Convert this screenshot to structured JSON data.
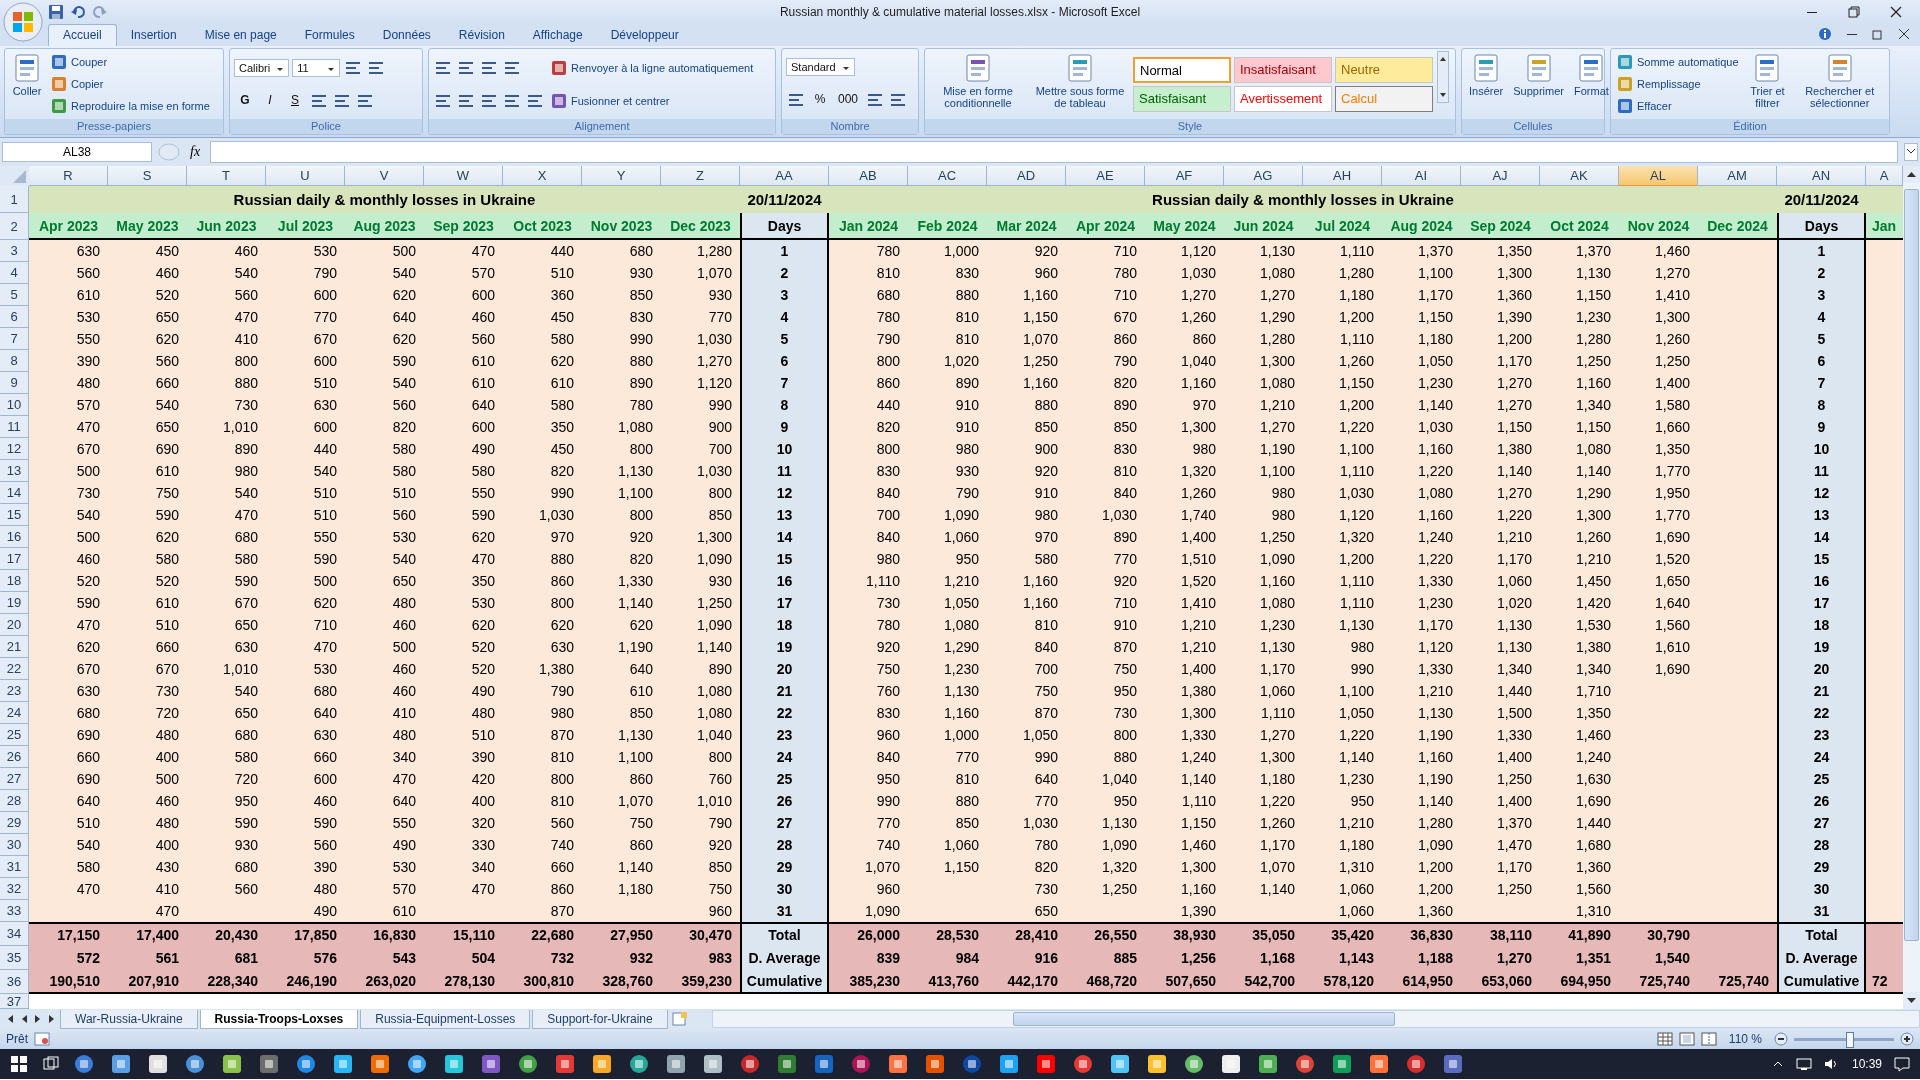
{
  "window": {
    "title": "Russian monthly & cumulative material losses.xlsx - Microsoft Excel"
  },
  "ribbon": {
    "tabs": [
      {
        "label": "Accueil",
        "selected": true
      },
      {
        "label": "Insertion",
        "selected": false
      },
      {
        "label": "Mise en page",
        "selected": false
      },
      {
        "label": "Formules",
        "selected": false
      },
      {
        "label": "Données",
        "selected": false
      },
      {
        "label": "Révision",
        "selected": false
      },
      {
        "label": "Affichage",
        "selected": false
      },
      {
        "label": "Développeur",
        "selected": false
      }
    ],
    "groups": [
      {
        "label": "Presse-papiers",
        "blocks": [
          {
            "kind": "large",
            "label": "Coller"
          },
          {
            "kind": "stack",
            "lines": [
              [
                {
                  "kind": "small",
                  "label": "Couper"
                }
              ],
              [
                {
                  "kind": "small",
                  "label": "Copier"
                }
              ],
              [
                {
                  "kind": "small",
                  "label": "Reproduire la mise en forme"
                }
              ]
            ]
          }
        ]
      },
      {
        "label": "Police",
        "blocks": [
          {
            "kind": "stack",
            "lines": [
              [
                {
                  "kind": "field",
                  "value": "Calibri"
                },
                {
                  "kind": "field",
                  "value": "11"
                },
                {
                  "kind": "icon"
                },
                {
                  "kind": "icon"
                }
              ],
              [
                {
                  "kind": "bold",
                  "text": "G"
                },
                {
                  "kind": "italic",
                  "text": "I"
                },
                {
                  "kind": "underline",
                  "text": "S"
                },
                {
                  "kind": "icon"
                },
                {
                  "kind": "icon"
                },
                {
                  "kind": "icon"
                }
              ]
            ]
          }
        ]
      },
      {
        "label": "Alignement",
        "blocks": [
          {
            "kind": "stack",
            "lines": [
              [
                {
                  "kind": "icon"
                },
                {
                  "kind": "icon"
                },
                {
                  "kind": "icon"
                },
                {
                  "kind": "icon"
                }
              ],
              [
                {
                  "kind": "icon"
                },
                {
                  "kind": "icon"
                },
                {
                  "kind": "icon"
                },
                {
                  "kind": "icon"
                },
                {
                  "kind": "icon"
                }
              ]
            ]
          },
          {
            "kind": "stack",
            "lines": [
              [
                {
                  "kind": "small",
                  "label": "Renvoyer à la ligne automatiquement"
                }
              ],
              [
                {
                  "kind": "small",
                  "label": "Fusionner et centrer"
                }
              ]
            ]
          }
        ]
      },
      {
        "label": "Nombre",
        "blocks": [
          {
            "kind": "stack",
            "lines": [
              [
                {
                  "kind": "field",
                  "value": "Standard"
                }
              ],
              [
                {
                  "kind": "icon"
                },
                {
                  "kind": "glyph",
                  "text": "%"
                },
                {
                  "kind": "glyph",
                  "text": "000"
                },
                {
                  "kind": "icon"
                },
                {
                  "kind": "icon"
                }
              ]
            ]
          }
        ]
      },
      {
        "label": "Style",
        "blocks": [
          {
            "kind": "large",
            "label": "Mise en forme conditionnelle"
          },
          {
            "kind": "large",
            "label": "Mettre sous forme de tableau"
          },
          {
            "kind": "gallery",
            "styles": [
              {
                "label": "Normal",
                "kind": "normal",
                "selected": true
              },
              {
                "label": "Insatisfaisant",
                "kind": "bad",
                "selected": false
              },
              {
                "label": "Neutre",
                "kind": "neutral",
                "selected": false
              },
              {
                "label": "Satisfaisant",
                "kind": "good",
                "selected": false
              },
              {
                "label": "Avertissement",
                "kind": "warning",
                "selected": false
              },
              {
                "label": "Calcul",
                "kind": "calc",
                "selected": false
              }
            ]
          }
        ]
      },
      {
        "label": "Cellules",
        "blocks": [
          {
            "kind": "large",
            "label": "Insérer"
          },
          {
            "kind": "large",
            "label": "Supprimer"
          },
          {
            "kind": "large",
            "label": "Format"
          }
        ]
      },
      {
        "label": "Édition",
        "blocks": [
          {
            "kind": "stack",
            "lines": [
              [
                {
                  "kind": "small",
                  "label": "Somme automatique"
                }
              ],
              [
                {
                  "kind": "small",
                  "label": "Remplissage"
                }
              ],
              [
                {
                  "kind": "small",
                  "label": "Effacer"
                }
              ]
            ]
          },
          {
            "kind": "large",
            "label": "Trier et filtrer"
          },
          {
            "kind": "large",
            "label": "Rechercher et sélectionner"
          }
        ]
      }
    ]
  },
  "formula_bar": {
    "name_box": "AL38",
    "function_label": "fx"
  },
  "sheet": {
    "columns": [
      {
        "label": "R",
        "kind": "month",
        "selected": false
      },
      {
        "label": "S",
        "kind": "month",
        "selected": false
      },
      {
        "label": "T",
        "kind": "month",
        "selected": false
      },
      {
        "label": "U",
        "kind": "month",
        "selected": false
      },
      {
        "label": "V",
        "kind": "month",
        "selected": false
      },
      {
        "label": "W",
        "kind": "month",
        "selected": false
      },
      {
        "label": "X",
        "kind": "month",
        "selected": false
      },
      {
        "label": "Y",
        "kind": "month",
        "selected": false
      },
      {
        "label": "Z",
        "kind": "month",
        "selected": false
      },
      {
        "label": "AA",
        "kind": "days",
        "selected": false
      },
      {
        "label": "AB",
        "kind": "month",
        "selected": false
      },
      {
        "label": "AC",
        "kind": "month",
        "selected": false
      },
      {
        "label": "AD",
        "kind": "month",
        "selected": false
      },
      {
        "label": "AE",
        "kind": "month",
        "selected": false
      },
      {
        "label": "AF",
        "kind": "month",
        "selected": false
      },
      {
        "label": "AG",
        "kind": "month",
        "selected": false
      },
      {
        "label": "AH",
        "kind": "month",
        "selected": false
      },
      {
        "label": "AI",
        "kind": "month",
        "selected": false
      },
      {
        "label": "AJ",
        "kind": "month",
        "selected": false
      },
      {
        "label": "AK",
        "kind": "month",
        "selected": false
      },
      {
        "label": "AL",
        "kind": "month",
        "selected": true
      },
      {
        "label": "AM",
        "kind": "month",
        "selected": false
      },
      {
        "label": "AN",
        "kind": "days",
        "selected": false
      },
      {
        "label": "A",
        "kind": "partial",
        "selected": false
      }
    ],
    "rows": [
      {
        "number": "1",
        "kind": "banner",
        "cells": [
          "Russian daily & monthly losses in Ukraine",
          null,
          null,
          null,
          null,
          null,
          null,
          null,
          null,
          "20/11/2024",
          "Russian daily & monthly losses in Ukraine",
          null,
          null,
          null,
          null,
          null,
          null,
          null,
          null,
          null,
          null,
          null,
          "20/11/2024",
          null
        ]
      },
      {
        "number": "2",
        "kind": "months",
        "cells": [
          "Apr 2023",
          "May 2023",
          "Jun 2023",
          "Jul 2023",
          "Aug 2023",
          "Sep 2023",
          "Oct 2023",
          "Nov 2023",
          "Dec 2023",
          "Days",
          "Jan 2024",
          "Feb 2024",
          "Mar 2024",
          "Apr 2024",
          "May 2024",
          "Jun 2024",
          "Jul 2024",
          "Aug 2024",
          "Sep 2024",
          "Oct 2024",
          "Nov 2024",
          "Dec 2024",
          "Days",
          "Jan"
        ]
      },
      {
        "number": "3",
        "kind": "data",
        "cells": [
          "630",
          "450",
          "460",
          "530",
          "500",
          "470",
          "440",
          "680",
          "1,280",
          "1",
          "780",
          "1,000",
          "920",
          "710",
          "1,120",
          "1,130",
          "1,110",
          "1,370",
          "1,350",
          "1,370",
          "1,460",
          null,
          "1",
          null
        ]
      },
      {
        "number": "4",
        "kind": "data",
        "cells": [
          "560",
          "460",
          "540",
          "790",
          "540",
          "570",
          "510",
          "930",
          "1,070",
          "2",
          "810",
          "830",
          "960",
          "780",
          "1,030",
          "1,080",
          "1,280",
          "1,100",
          "1,300",
          "1,130",
          "1,270",
          null,
          "2",
          null
        ]
      },
      {
        "number": "5",
        "kind": "data",
        "cells": [
          "610",
          "520",
          "560",
          "600",
          "620",
          "600",
          "360",
          "850",
          "930",
          "3",
          "680",
          "880",
          "1,160",
          "710",
          "1,270",
          "1,270",
          "1,180",
          "1,170",
          "1,360",
          "1,150",
          "1,410",
          null,
          "3",
          null
        ]
      },
      {
        "number": "6",
        "kind": "data",
        "cells": [
          "530",
          "650",
          "470",
          "770",
          "640",
          "460",
          "450",
          "830",
          "770",
          "4",
          "780",
          "810",
          "1,150",
          "670",
          "1,260",
          "1,290",
          "1,200",
          "1,150",
          "1,390",
          "1,230",
          "1,300",
          null,
          "4",
          null
        ]
      },
      {
        "number": "7",
        "kind": "data",
        "cells": [
          "550",
          "620",
          "410",
          "670",
          "620",
          "560",
          "580",
          "990",
          "1,030",
          "5",
          "790",
          "810",
          "1,070",
          "860",
          "860",
          "1,280",
          "1,110",
          "1,180",
          "1,200",
          "1,280",
          "1,260",
          null,
          "5",
          null
        ]
      },
      {
        "number": "8",
        "kind": "data",
        "cells": [
          "390",
          "560",
          "800",
          "600",
          "590",
          "610",
          "620",
          "880",
          "1,270",
          "6",
          "800",
          "1,020",
          "1,250",
          "790",
          "1,040",
          "1,300",
          "1,260",
          "1,050",
          "1,170",
          "1,250",
          "1,250",
          null,
          "6",
          null
        ]
      },
      {
        "number": "9",
        "kind": "data",
        "cells": [
          "480",
          "660",
          "880",
          "510",
          "540",
          "610",
          "610",
          "890",
          "1,120",
          "7",
          "860",
          "890",
          "1,160",
          "820",
          "1,160",
          "1,080",
          "1,150",
          "1,230",
          "1,270",
          "1,160",
          "1,400",
          null,
          "7",
          null
        ]
      },
      {
        "number": "10",
        "kind": "data",
        "cells": [
          "570",
          "540",
          "730",
          "630",
          "560",
          "640",
          "580",
          "780",
          "990",
          "8",
          "440",
          "910",
          "880",
          "890",
          "970",
          "1,210",
          "1,200",
          "1,140",
          "1,270",
          "1,340",
          "1,580",
          null,
          "8",
          null
        ]
      },
      {
        "number": "11",
        "kind": "data",
        "cells": [
          "470",
          "650",
          "1,010",
          "600",
          "820",
          "600",
          "350",
          "1,080",
          "900",
          "9",
          "820",
          "910",
          "850",
          "850",
          "1,300",
          "1,270",
          "1,220",
          "1,030",
          "1,150",
          "1,150",
          "1,660",
          null,
          "9",
          null
        ]
      },
      {
        "number": "12",
        "kind": "data",
        "cells": [
          "670",
          "690",
          "890",
          "440",
          "580",
          "490",
          "450",
          "800",
          "700",
          "10",
          "800",
          "980",
          "900",
          "830",
          "980",
          "1,190",
          "1,100",
          "1,160",
          "1,380",
          "1,080",
          "1,350",
          null,
          "10",
          null
        ]
      },
      {
        "number": "13",
        "kind": "data",
        "cells": [
          "500",
          "610",
          "980",
          "540",
          "580",
          "580",
          "820",
          "1,130",
          "1,030",
          "11",
          "830",
          "930",
          "920",
          "810",
          "1,320",
          "1,100",
          "1,110",
          "1,220",
          "1,140",
          "1,140",
          "1,770",
          null,
          "11",
          null
        ]
      },
      {
        "number": "14",
        "kind": "data",
        "cells": [
          "730",
          "750",
          "540",
          "510",
          "510",
          "550",
          "990",
          "1,100",
          "800",
          "12",
          "840",
          "790",
          "910",
          "840",
          "1,260",
          "980",
          "1,030",
          "1,080",
          "1,270",
          "1,290",
          "1,950",
          null,
          "12",
          null
        ]
      },
      {
        "number": "15",
        "kind": "data",
        "cells": [
          "540",
          "590",
          "470",
          "510",
          "560",
          "590",
          "1,030",
          "800",
          "850",
          "13",
          "700",
          "1,090",
          "980",
          "1,030",
          "1,740",
          "980",
          "1,120",
          "1,160",
          "1,220",
          "1,300",
          "1,770",
          null,
          "13",
          null
        ]
      },
      {
        "number": "16",
        "kind": "data",
        "cells": [
          "500",
          "620",
          "680",
          "550",
          "530",
          "620",
          "970",
          "920",
          "1,300",
          "14",
          "840",
          "1,060",
          "970",
          "890",
          "1,400",
          "1,250",
          "1,320",
          "1,240",
          "1,210",
          "1,260",
          "1,690",
          null,
          "14",
          null
        ]
      },
      {
        "number": "17",
        "kind": "data",
        "cells": [
          "460",
          "580",
          "580",
          "590",
          "540",
          "470",
          "880",
          "820",
          "1,090",
          "15",
          "980",
          "950",
          "580",
          "770",
          "1,510",
          "1,090",
          "1,200",
          "1,220",
          "1,170",
          "1,210",
          "1,520",
          null,
          "15",
          null
        ]
      },
      {
        "number": "18",
        "kind": "data",
        "cells": [
          "520",
          "520",
          "590",
          "500",
          "650",
          "350",
          "860",
          "1,330",
          "930",
          "16",
          "1,110",
          "1,210",
          "1,160",
          "920",
          "1,520",
          "1,160",
          "1,110",
          "1,330",
          "1,060",
          "1,450",
          "1,650",
          null,
          "16",
          null
        ]
      },
      {
        "number": "19",
        "kind": "data",
        "cells": [
          "590",
          "610",
          "670",
          "620",
          "480",
          "530",
          "800",
          "1,140",
          "1,250",
          "17",
          "730",
          "1,050",
          "1,160",
          "710",
          "1,410",
          "1,080",
          "1,110",
          "1,230",
          "1,020",
          "1,420",
          "1,640",
          null,
          "17",
          null
        ]
      },
      {
        "number": "20",
        "kind": "data",
        "cells": [
          "470",
          "510",
          "650",
          "710",
          "460",
          "620",
          "620",
          "620",
          "1,090",
          "18",
          "780",
          "1,080",
          "810",
          "910",
          "1,210",
          "1,230",
          "1,130",
          "1,170",
          "1,130",
          "1,530",
          "1,560",
          null,
          "18",
          null
        ]
      },
      {
        "number": "21",
        "kind": "data",
        "cells": [
          "620",
          "660",
          "630",
          "470",
          "500",
          "520",
          "630",
          "1,190",
          "1,140",
          "19",
          "920",
          "1,290",
          "840",
          "870",
          "1,210",
          "1,130",
          "980",
          "1,120",
          "1,130",
          "1,380",
          "1,610",
          null,
          "19",
          null
        ]
      },
      {
        "number": "22",
        "kind": "data",
        "cells": [
          "670",
          "670",
          "1,010",
          "530",
          "460",
          "520",
          "1,380",
          "640",
          "890",
          "20",
          "750",
          "1,230",
          "700",
          "750",
          "1,400",
          "1,170",
          "990",
          "1,330",
          "1,340",
          "1,340",
          "1,690",
          null,
          "20",
          null
        ]
      },
      {
        "number": "23",
        "kind": "data",
        "cells": [
          "630",
          "730",
          "540",
          "680",
          "460",
          "490",
          "790",
          "610",
          "1,080",
          "21",
          "760",
          "1,130",
          "750",
          "950",
          "1,380",
          "1,060",
          "1,100",
          "1,210",
          "1,440",
          "1,710",
          null,
          null,
          "21",
          null
        ]
      },
      {
        "number": "24",
        "kind": "data",
        "cells": [
          "680",
          "720",
          "650",
          "640",
          "410",
          "480",
          "980",
          "850",
          "1,080",
          "22",
          "830",
          "1,160",
          "870",
          "730",
          "1,300",
          "1,110",
          "1,050",
          "1,130",
          "1,500",
          "1,350",
          null,
          null,
          "22",
          null
        ]
      },
      {
        "number": "25",
        "kind": "data",
        "cells": [
          "690",
          "480",
          "680",
          "630",
          "480",
          "510",
          "870",
          "1,130",
          "1,040",
          "23",
          "960",
          "1,000",
          "1,050",
          "800",
          "1,330",
          "1,270",
          "1,220",
          "1,190",
          "1,330",
          "1,460",
          null,
          null,
          "23",
          null
        ]
      },
      {
        "number": "26",
        "kind": "data",
        "cells": [
          "660",
          "400",
          "580",
          "660",
          "340",
          "390",
          "810",
          "1,100",
          "800",
          "24",
          "840",
          "770",
          "990",
          "880",
          "1,240",
          "1,300",
          "1,140",
          "1,160",
          "1,400",
          "1,240",
          null,
          null,
          "24",
          null
        ]
      },
      {
        "number": "27",
        "kind": "data",
        "cells": [
          "690",
          "500",
          "720",
          "600",
          "470",
          "420",
          "800",
          "860",
          "760",
          "25",
          "950",
          "810",
          "640",
          "1,040",
          "1,140",
          "1,180",
          "1,230",
          "1,190",
          "1,250",
          "1,630",
          null,
          null,
          "25",
          null
        ]
      },
      {
        "number": "28",
        "kind": "data",
        "cells": [
          "640",
          "460",
          "950",
          "460",
          "640",
          "400",
          "810",
          "1,070",
          "1,010",
          "26",
          "990",
          "880",
          "770",
          "950",
          "1,110",
          "1,220",
          "950",
          "1,140",
          "1,400",
          "1,690",
          null,
          null,
          "26",
          null
        ]
      },
      {
        "number": "29",
        "kind": "data",
        "cells": [
          "510",
          "480",
          "590",
          "590",
          "550",
          "320",
          "560",
          "750",
          "790",
          "27",
          "770",
          "850",
          "1,030",
          "1,130",
          "1,150",
          "1,260",
          "1,210",
          "1,280",
          "1,370",
          "1,440",
          null,
          null,
          "27",
          null
        ]
      },
      {
        "number": "30",
        "kind": "data",
        "cells": [
          "540",
          "400",
          "930",
          "560",
          "490",
          "330",
          "740",
          "860",
          "920",
          "28",
          "740",
          "1,060",
          "780",
          "1,090",
          "1,460",
          "1,170",
          "1,180",
          "1,090",
          "1,470",
          "1,680",
          null,
          null,
          "28",
          null
        ]
      },
      {
        "number": "31",
        "kind": "data",
        "cells": [
          "580",
          "430",
          "680",
          "390",
          "530",
          "340",
          "660",
          "1,140",
          "850",
          "29",
          "1,070",
          "1,150",
          "820",
          "1,320",
          "1,300",
          "1,070",
          "1,310",
          "1,200",
          "1,170",
          "1,360",
          null,
          null,
          "29",
          null
        ]
      },
      {
        "number": "32",
        "kind": "data",
        "cells": [
          "470",
          "410",
          "560",
          "480",
          "570",
          "470",
          "860",
          "1,180",
          "750",
          "30",
          "960",
          null,
          "730",
          "1,250",
          "1,160",
          "1,140",
          "1,060",
          "1,200",
          "1,250",
          "1,560",
          null,
          null,
          "30",
          null
        ]
      },
      {
        "number": "33",
        "kind": "data",
        "cells": [
          null,
          "470",
          null,
          "490",
          "610",
          null,
          "870",
          null,
          "960",
          "31",
          "1,090",
          null,
          "650",
          null,
          "1,390",
          null,
          "1,060",
          "1,360",
          null,
          "1,310",
          null,
          null,
          "31",
          null
        ]
      },
      {
        "number": "34",
        "kind": "summary",
        "cells": [
          "17,150",
          "17,400",
          "20,430",
          "17,850",
          "16,830",
          "15,110",
          "22,680",
          "27,950",
          "30,470",
          "Total",
          "26,000",
          "28,530",
          "28,410",
          "26,550",
          "38,930",
          "35,050",
          "35,420",
          "36,830",
          "38,110",
          "41,890",
          "30,790",
          null,
          "Total",
          null
        ]
      },
      {
        "number": "35",
        "kind": "summary",
        "cells": [
          "572",
          "561",
          "681",
          "576",
          "543",
          "504",
          "732",
          "932",
          "983",
          "D. Average",
          "839",
          "984",
          "916",
          "885",
          "1,256",
          "1,168",
          "1,143",
          "1,188",
          "1,270",
          "1,351",
          "1,540",
          null,
          "D. Average",
          null
        ]
      },
      {
        "number": "36",
        "kind": "summary",
        "cells": [
          "190,510",
          "207,910",
          "228,340",
          "246,190",
          "263,020",
          "278,130",
          "300,810",
          "328,760",
          "359,230",
          "Cumulative",
          "385,230",
          "413,760",
          "442,170",
          "468,720",
          "507,650",
          "542,700",
          "578,120",
          "614,950",
          "653,060",
          "694,950",
          "725,740",
          "725,740",
          "Cumulative",
          "72"
        ]
      },
      {
        "number": "37",
        "kind": "blank"
      }
    ]
  },
  "sheet_tabs": [
    {
      "label": "War-Russia-Ukraine",
      "selected": false
    },
    {
      "label": "Russia-Troops-Loxses",
      "selected": true
    },
    {
      "label": "Russia-Equipment-Losses",
      "selected": false
    },
    {
      "label": "Support-for-Ukraine",
      "selected": false
    }
  ],
  "status_bar": {
    "mode": "Prêt",
    "zoom": "110 %",
    "zoom_slider": {
      "level": 0.55
    }
  },
  "taskbar": {
    "time": "10:39"
  }
}
